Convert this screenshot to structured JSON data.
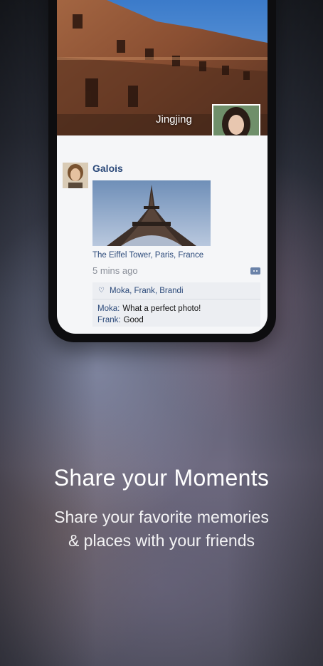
{
  "moments": {
    "cover_name": "Jingjing",
    "post": {
      "author": "Galois",
      "location": "The Eiffel Tower, Paris, France",
      "time": "5 mins ago",
      "likes": "Moka, Frank, Brandi",
      "comments": [
        {
          "name": "Moka:",
          "text": "What a perfect photo!"
        },
        {
          "name": "Frank:",
          "text": "Good"
        }
      ]
    }
  },
  "promo": {
    "title": "Share your Moments",
    "subtitle_line1": "Share your favorite memories",
    "subtitle_line2": "& places with your friends"
  },
  "icons": {
    "like": "heart-icon",
    "comment": "comment-icon"
  },
  "colors": {
    "link_blue": "#2c4a7a",
    "timestamp_gray": "#8a8f99",
    "panel_bg": "#eceef2"
  }
}
